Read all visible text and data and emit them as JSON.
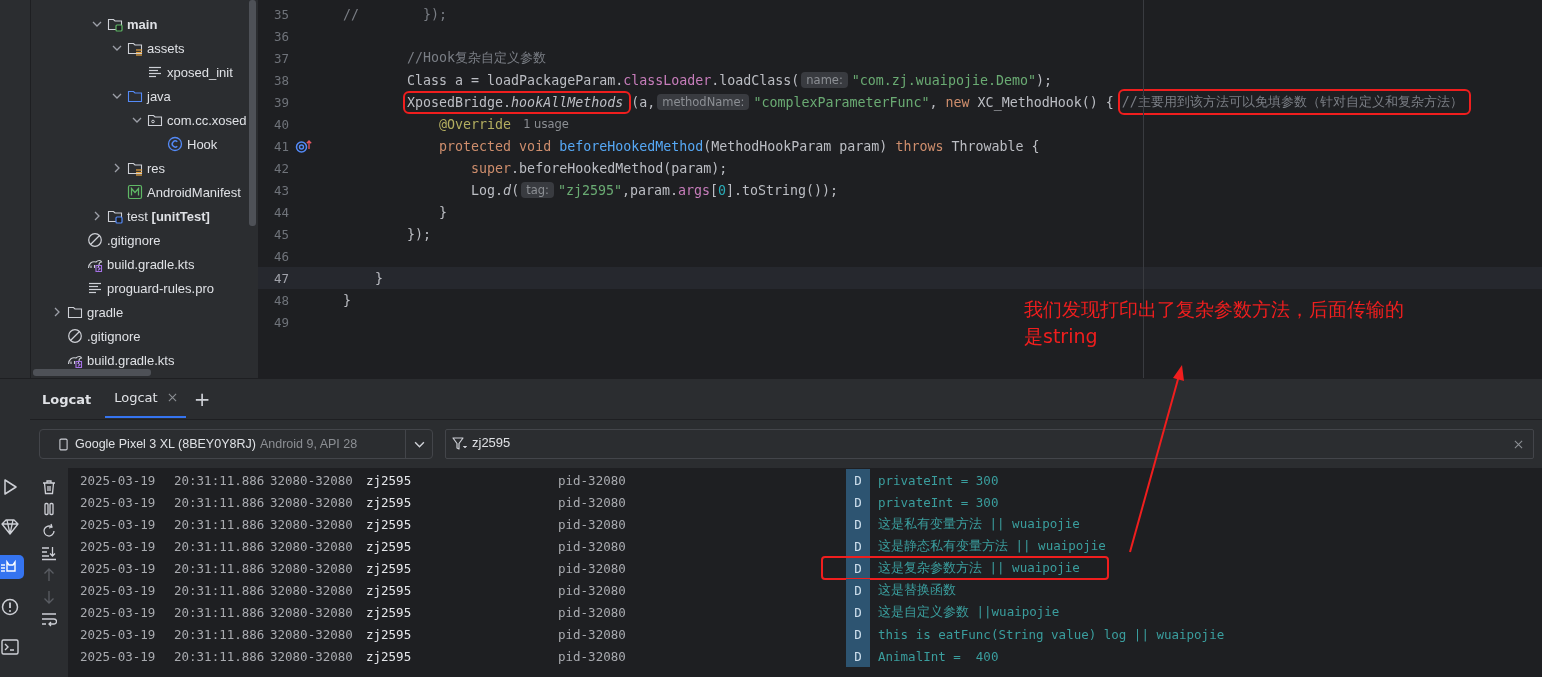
{
  "project_tree": [
    {
      "children": [
        {
          "children": [
            {
              "label": "main",
              "kind": "folder-module",
              "bold": true,
              "expanded": true,
              "children": [
                {
                  "label": "assets",
                  "kind": "folder-res",
                  "expanded": true,
                  "children": [
                    {
                      "label": "xposed_init",
                      "kind": "text-file"
                    }
                  ]
                },
                {
                  "label": "java",
                  "kind": "folder-source",
                  "expanded": true,
                  "children": [
                    {
                      "label": "com.cc.xosed",
                      "kind": "package",
                      "expanded": true,
                      "children": [
                        {
                          "label": "Hook",
                          "kind": "class"
                        }
                      ]
                    }
                  ]
                },
                {
                  "label": "res",
                  "kind": "folder-res",
                  "expanded": false
                },
                {
                  "label": "AndroidManifest",
                  "kind": "manifest"
                }
              ]
            },
            {
              "label": "test **[unitTest]**",
              "kind": "folder-test",
              "expanded": false
            }
          ]
        },
        {
          "label": ".gitignore",
          "kind": "ignore"
        },
        {
          "label": "build.gradle.kts",
          "kind": "gradle"
        },
        {
          "label": "proguard-rules.pro",
          "kind": "text-file"
        }
      ]
    },
    {
      "label": "gradle",
      "kind": "folder",
      "expanded": false
    },
    {
      "label": ".gitignore",
      "kind": "ignore"
    },
    {
      "label": "build.gradle.kts",
      "kind": "gradle"
    }
  ],
  "editor": {
    "lines": [
      {
        "number": "35",
        "parts": [
          {
            "kind": "code",
            "tokens": [
              {
                "t": "//        });",
                "kind": "comment"
              }
            ]
          }
        ]
      },
      {
        "number": "36"
      },
      {
        "children": [
          {
            "children": [
              {
                "number": "37",
                "parts": [
                  {
                    "kind": "code",
                    "tokens": [
                      {
                        "t": "//Hook复杂自定义参数",
                        "kind": "comment"
                      }
                    ]
                  }
                ]
              },
              {
                "number": "38",
                "parts": [
                  {
                    "kind": "code",
                    "tokens": [
                      {
                        "t": "Class a = loadPackageParam.",
                        "kind": "plain"
                      },
                      {
                        "t": "classLoader",
                        "kind": "field"
                      },
                      {
                        "t": ".loadClass(",
                        "kind": "plain"
                      }
                    ]
                  },
                  {
                    "kind": "hint",
                    "text": "name:"
                  },
                  {
                    "kind": "code",
                    "tokens": [
                      {
                        "t": "\"com.zj.wuaipojie.Demo\"",
                        "kind": "string"
                      },
                      {
                        "t": ");",
                        "kind": "plain"
                      }
                    ]
                  }
                ]
              },
              {
                "number": "39",
                "parts": [
                  {
                    "kind": "box",
                    "parts": [
                      {
                        "kind": "code",
                        "tokens": [
                          {
                            "t": "XposedBridge.",
                            "kind": "plain"
                          },
                          {
                            "t": "hookAllMethods",
                            "kind": "static"
                          }
                        ]
                      }
                    ]
                  },
                  {
                    "kind": "code",
                    "tokens": [
                      {
                        "t": "(a,",
                        "kind": "plain"
                      }
                    ]
                  },
                  {
                    "kind": "hint",
                    "text": "methodName:"
                  },
                  {
                    "kind": "code",
                    "tokens": [
                      {
                        "t": "\"complexParameterFunc\"",
                        "kind": "string"
                      },
                      {
                        "t": ", ",
                        "kind": "plain"
                      },
                      {
                        "t": "new",
                        "kind": "keyword"
                      },
                      {
                        "t": " XC_MethodHook() { ",
                        "kind": "plain"
                      }
                    ]
                  },
                  {
                    "kind": "box",
                    "parts": [
                      {
                        "kind": "code",
                        "tokens": [
                          {
                            "t": "//主要用到该方法可以免填参数（针对自定义和复杂方法）",
                            "kind": "comment"
                          }
                        ]
                      }
                    ]
                  }
                ],
                "children": [
                  {
                    "number": "40",
                    "parts": [
                      {
                        "kind": "code",
                        "tokens": [
                          {
                            "t": "@Override",
                            "kind": "annotation"
                          }
                        ]
                      },
                      {
                        "kind": "usage",
                        "text": "1 usage"
                      }
                    ]
                  },
                  {
                    "number": "41",
                    "override_marker": true,
                    "parts": [
                      {
                        "kind": "code",
                        "tokens": [
                          {
                            "t": "protected void",
                            "kind": "keyword"
                          },
                          {
                            "t": " beforeHookedMethod",
                            "kind": "method"
                          },
                          {
                            "t": "(MethodHookParam param) ",
                            "kind": "plain"
                          },
                          {
                            "t": "throws",
                            "kind": "keyword"
                          },
                          {
                            "t": " Throwable {",
                            "kind": "plain"
                          }
                        ]
                      }
                    ],
                    "children": [
                      {
                        "number": "42",
                        "parts": [
                          {
                            "kind": "code",
                            "tokens": [
                              {
                                "t": "super",
                                "kind": "keyword"
                              },
                              {
                                "t": ".beforeHookedMethod(param);",
                                "kind": "plain"
                              }
                            ]
                          }
                        ]
                      },
                      {
                        "number": "43",
                        "parts": [
                          {
                            "kind": "code",
                            "tokens": [
                              {
                                "t": "Log.",
                                "kind": "plain"
                              },
                              {
                                "t": "d",
                                "kind": "static"
                              },
                              {
                                "t": "(",
                                "kind": "plain"
                              }
                            ]
                          },
                          {
                            "kind": "hint",
                            "text": "tag:"
                          },
                          {
                            "kind": "code",
                            "tokens": [
                              {
                                "t": "\"zj2595\"",
                                "kind": "string"
                              },
                              {
                                "t": ",param.",
                                "kind": "plain"
                              },
                              {
                                "t": "args",
                                "kind": "field"
                              },
                              {
                                "t": "[",
                                "kind": "plain"
                              },
                              {
                                "t": "0",
                                "kind": "number"
                              },
                              {
                                "t": "].toString());",
                                "kind": "plain"
                              }
                            ]
                          }
                        ]
                      }
                    ]
                  },
                  {
                    "number": "44",
                    "parts": [
                      {
                        "kind": "code",
                        "tokens": [
                          {
                            "t": "}",
                            "kind": "plain"
                          }
                        ]
                      }
                    ]
                  }
                ]
              },
              {
                "number": "45",
                "parts": [
                  {
                    "kind": "code",
                    "tokens": [
                      {
                        "t": "});",
                        "kind": "plain"
                      }
                    ]
                  }
                ]
              }
            ]
          },
          {
            "number": "46"
          },
          {
            "number": "47",
            "current": true,
            "parts": [
              {
                "kind": "code",
                "tokens": [
                  {
                    "t": "}",
                    "kind": "plain"
                  }
                ]
              }
            ]
          }
        ]
      },
      {
        "number": "48",
        "parts": [
          {
            "kind": "code",
            "tokens": [
              {
                "t": "}",
                "kind": "plain"
              }
            ]
          }
        ]
      },
      {
        "number": "49"
      }
    ]
  },
  "annotation": {
    "text": "我们发现打印出了复杂参数方法，后面传输的是string"
  },
  "tool_windows": [
    {
      "kind": "run",
      "selected": false
    },
    {
      "kind": "gem",
      "selected": false
    },
    {
      "kind": "logcat",
      "selected": true
    },
    {
      "kind": "problems",
      "selected": false
    },
    {
      "kind": "terminal",
      "selected": false
    }
  ],
  "logcat": {
    "title": "Logcat",
    "tabs": [
      {
        "label": "Logcat",
        "selected": true
      }
    ],
    "add_tab": "+",
    "device": {
      "name": "Google Pixel 3 XL (8BEY0Y8RJ)",
      "detail": "Android 9, API 28"
    },
    "filter": {
      "value": "zj2595"
    },
    "actions": [
      {
        "kind": "clear",
        "disabled": false
      },
      {
        "kind": "pause",
        "disabled": false
      },
      {
        "kind": "restart",
        "disabled": false
      },
      {
        "kind": "scroll-end",
        "disabled": false
      },
      {
        "kind": "up",
        "disabled": true
      },
      {
        "kind": "down",
        "disabled": true
      },
      {
        "kind": "wrap",
        "disabled": false
      }
    ],
    "rows": [
      {
        "date": "2025-03-19",
        "time": "20:31:11.886",
        "pid_tid": "32080-32080",
        "tag": "zj2595",
        "package": "pid-32080",
        "level": "D",
        "message": "privateInt = 300",
        "highlighted": false
      },
      {
        "date": "2025-03-19",
        "time": "20:31:11.886",
        "pid_tid": "32080-32080",
        "tag": "zj2595",
        "package": "pid-32080",
        "level": "D",
        "message": "privateInt = 300",
        "highlighted": false
      },
      {
        "date": "2025-03-19",
        "time": "20:31:11.886",
        "pid_tid": "32080-32080",
        "tag": "zj2595",
        "package": "pid-32080",
        "level": "D",
        "message": "这是私有变量方法 || wuaipojie",
        "highlighted": false
      },
      {
        "date": "2025-03-19",
        "time": "20:31:11.886",
        "pid_tid": "32080-32080",
        "tag": "zj2595",
        "package": "pid-32080",
        "level": "D",
        "message": "这是静态私有变量方法 || wuaipojie",
        "highlighted": false
      },
      {
        "date": "2025-03-19",
        "time": "20:31:11.886",
        "pid_tid": "32080-32080",
        "tag": "zj2595",
        "package": "pid-32080",
        "level": "D",
        "message": "这是复杂参数方法 || wuaipojie",
        "highlighted": true
      },
      {
        "date": "2025-03-19",
        "time": "20:31:11.886",
        "pid_tid": "32080-32080",
        "tag": "zj2595",
        "package": "pid-32080",
        "level": "D",
        "message": "这是替换函数",
        "highlighted": false
      },
      {
        "date": "2025-03-19",
        "time": "20:31:11.886",
        "pid_tid": "32080-32080",
        "tag": "zj2595",
        "package": "pid-32080",
        "level": "D",
        "message": "这是自定义参数 ||wuaipojie",
        "highlighted": false
      },
      {
        "date": "2025-03-19",
        "time": "20:31:11.886",
        "pid_tid": "32080-32080",
        "tag": "zj2595",
        "package": "pid-32080",
        "level": "D",
        "message": "this is eatFunc(String value) log || wuaipojie",
        "highlighted": false
      },
      {
        "date": "2025-03-19",
        "time": "20:31:11.886",
        "pid_tid": "32080-32080",
        "tag": "zj2595",
        "package": "pid-32080",
        "level": "D",
        "message": "AnimalInt =  400",
        "highlighted": false
      }
    ]
  }
}
